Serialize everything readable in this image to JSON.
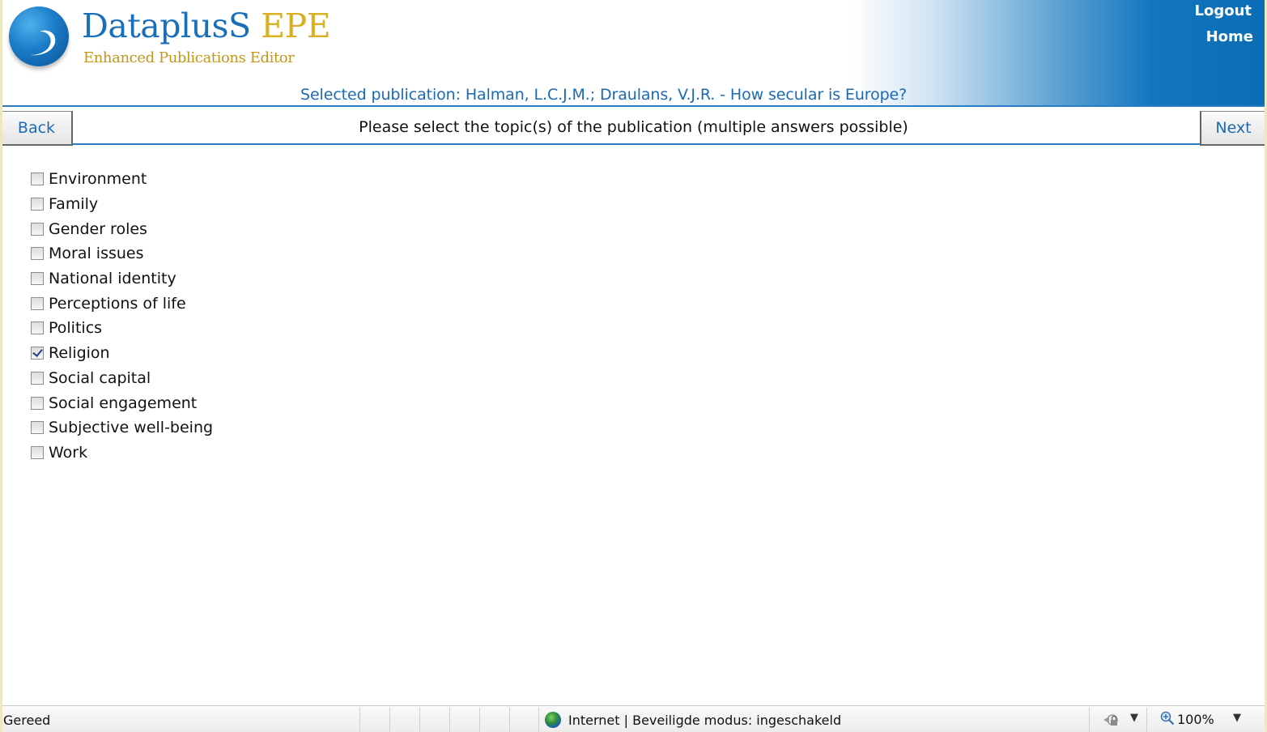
{
  "header": {
    "logo_name": "DataplusS",
    "logo_name_accent": "EPE",
    "logo_subtitle": "Enhanced Publications Editor",
    "logout_label": "Logout",
    "home_label": "Home",
    "selected_publication": "Selected publication: Halman, L.C.J.M.; Draulans, V.J.R. - How secular is Europe?"
  },
  "nav": {
    "back_label": "Back",
    "next_label": "Next",
    "question": "Please select the topic(s) of the publication (multiple answers possible)"
  },
  "topics": [
    {
      "label": "Environment",
      "checked": false
    },
    {
      "label": "Family",
      "checked": false
    },
    {
      "label": "Gender roles",
      "checked": false
    },
    {
      "label": "Moral issues",
      "checked": false
    },
    {
      "label": "National identity",
      "checked": false
    },
    {
      "label": "Perceptions of life",
      "checked": false
    },
    {
      "label": "Politics",
      "checked": false
    },
    {
      "label": "Religion",
      "checked": true
    },
    {
      "label": "Social capital",
      "checked": false
    },
    {
      "label": "Social engagement",
      "checked": false
    },
    {
      "label": "Subjective well-being",
      "checked": false
    },
    {
      "label": "Work",
      "checked": false
    }
  ],
  "statusbar": {
    "status": "Gereed",
    "zone": "Internet | Beveiligde modus: ingeschakeld",
    "zoom": "100%",
    "zone_icon": "globe-icon",
    "security_icon": "protected-mode-icon",
    "zoom_icon": "magnifier-icon"
  },
  "colors": {
    "brand_blue": "#1b6fb8",
    "brand_gold": "#d8b024",
    "link_blue": "#1a6ab5",
    "header_gradient_end": "#0a6db6"
  }
}
